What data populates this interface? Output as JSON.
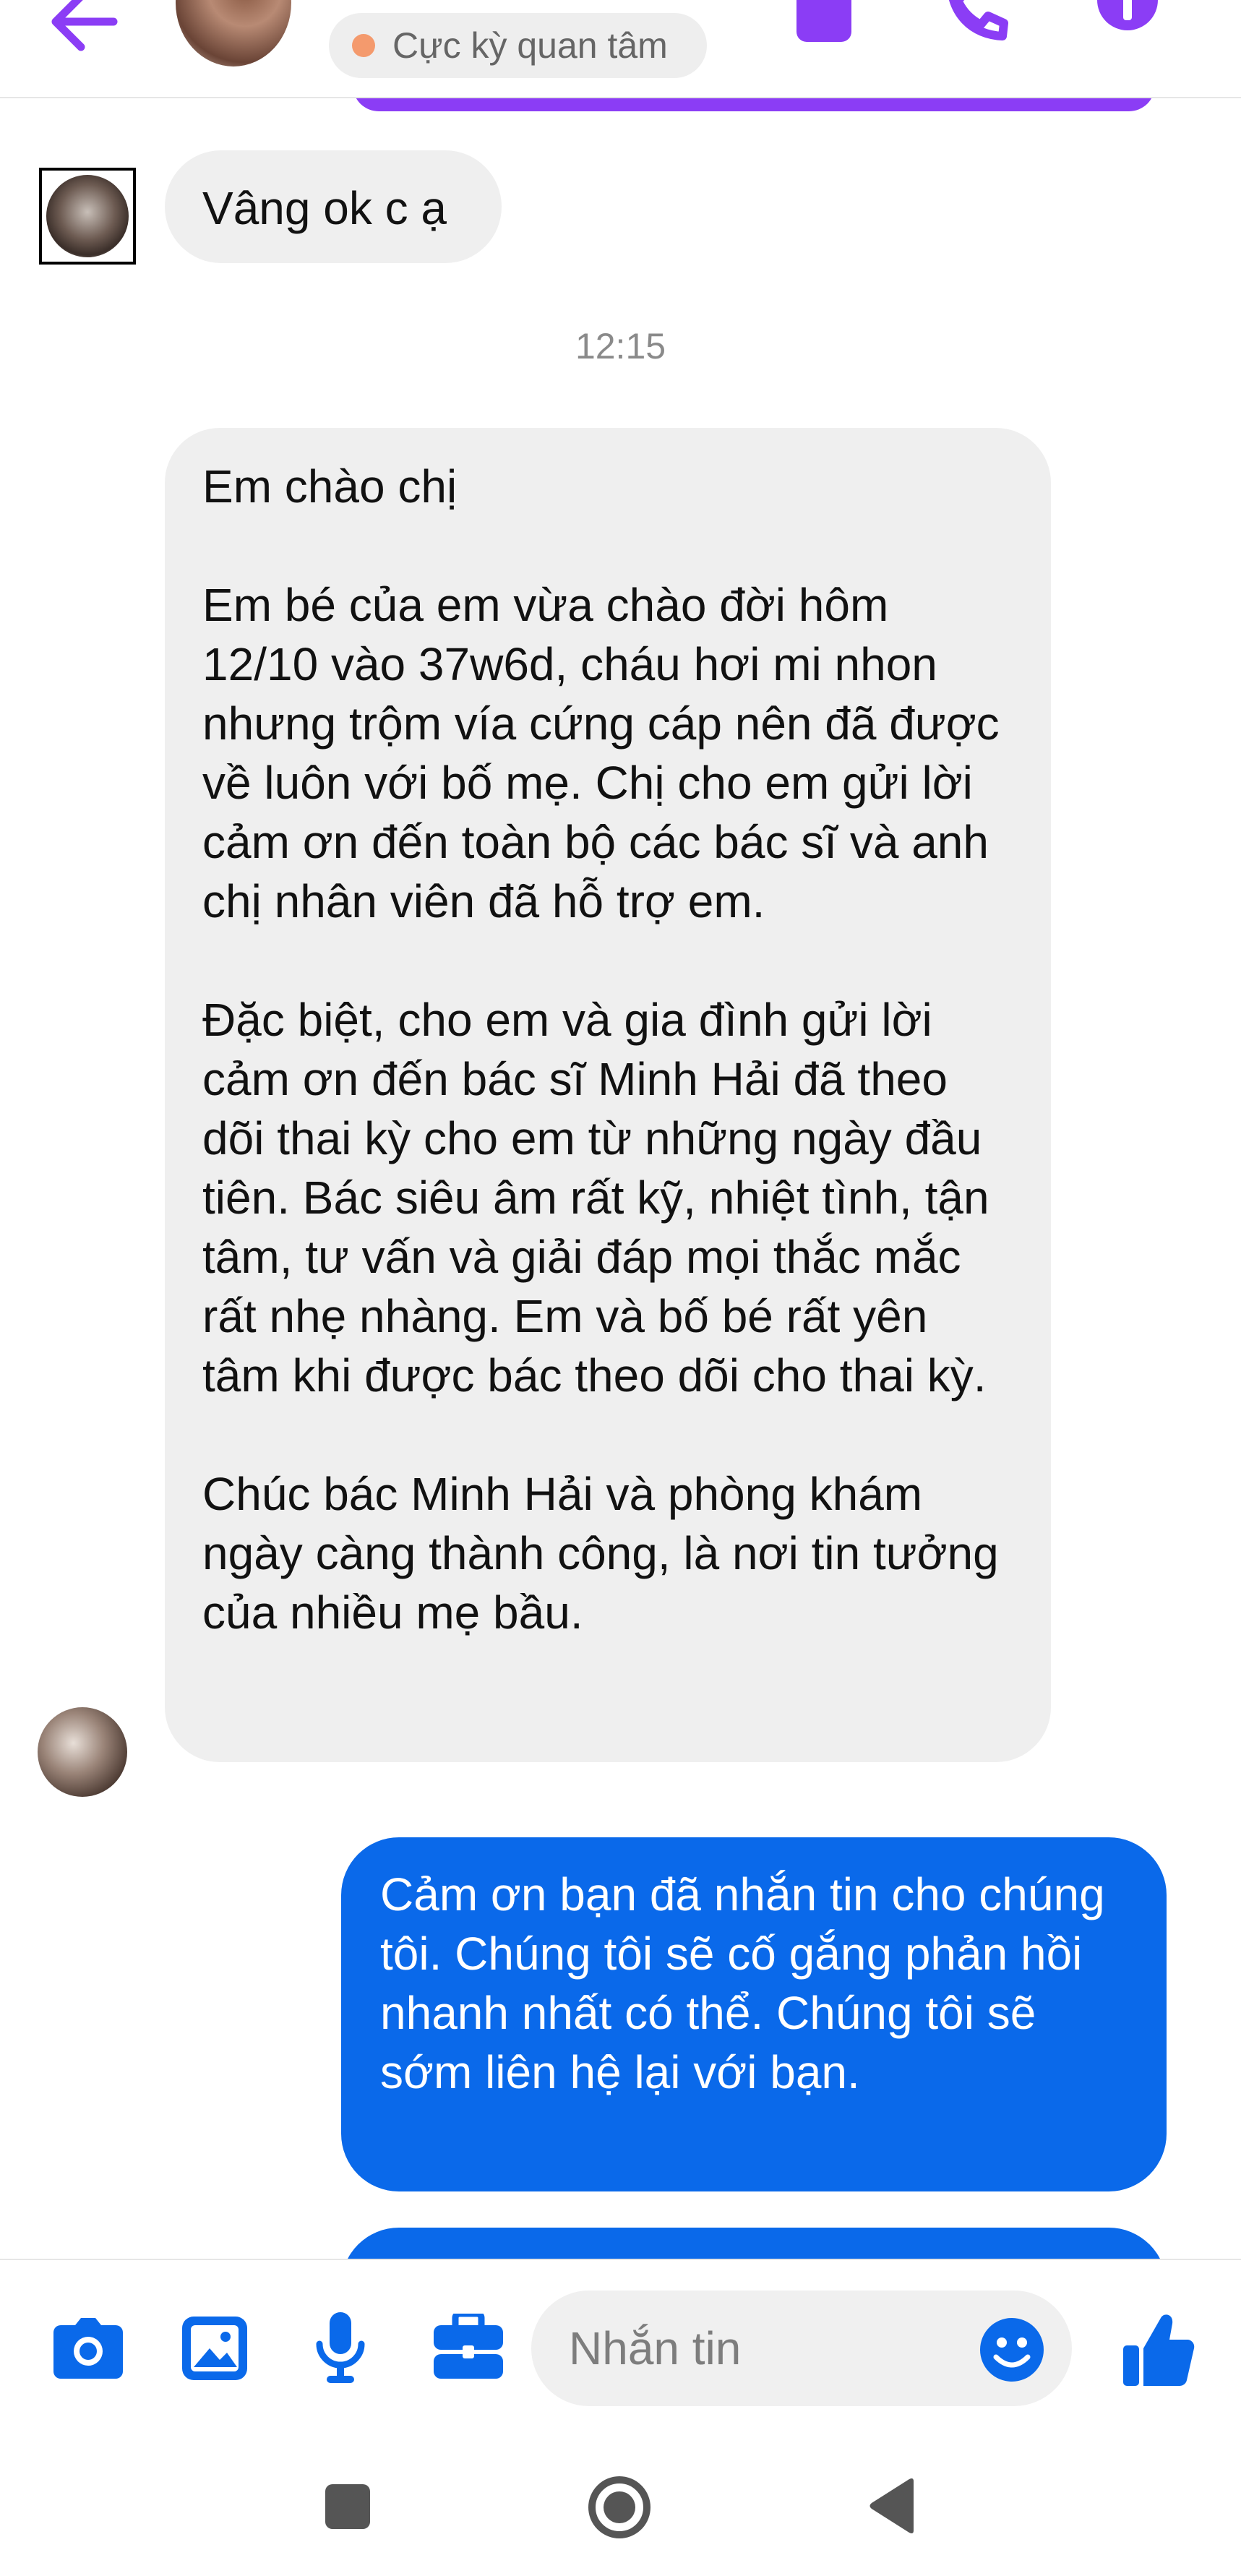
{
  "header": {
    "status_label": "Cực kỳ quan tâm",
    "accent_color": "#8b3df5",
    "icons": [
      "back-arrow-icon",
      "contact-avatar",
      "video-call-icon",
      "phone-icon",
      "info-icon"
    ]
  },
  "messages": {
    "msg1": "Vâng ok c ạ",
    "timestamp": "12:15",
    "msg2": {
      "p1": "Em chào chị",
      "p2": "Em bé của em vừa chào đời hôm 12/10 vào 37w6d, cháu hơi mi nhon nhưng trộm vía cứng cáp nên đã được về luôn với bố mẹ. Chị cho em gửi lời cảm ơn đến toàn bộ các bác sĩ và anh chị nhân viên đã hỗ trợ em.",
      "p3": "Đặc biệt, cho em và gia đình gửi lời cảm ơn đến bác sĩ Minh Hải đã theo dõi thai kỳ cho em từ những ngày đầu tiên. Bác siêu âm rất kỹ, nhiệt tình, tận tâm, tư vấn và giải đáp mọi thắc mắc rất nhẹ nhàng. Em và bố bé rất yên tâm khi được bác theo dõi cho thai kỳ.",
      "p4": "Chúc bác Minh Hải và phòng khám ngày càng thành công, là nơi tin tưởng của nhiều mẹ bầu."
    },
    "msg3": "Cảm ơn bạn đã nhắn tin cho chúng tôi. Chúng tôi sẽ cố gắng phản hồi nhanh nhất có thể. Chúng tôi sẽ sớm liên hệ lại với bạn.",
    "incoming_bubble_color": "#efefef",
    "outgoing_bubble_color": "#0a69ea"
  },
  "composer": {
    "placeholder": "Nhắn tin",
    "icons": [
      "camera-icon",
      "gallery-icon",
      "microphone-icon",
      "briefcase-icon",
      "emoji-icon",
      "thumbs-up-icon"
    ],
    "icon_color": "#0a69ea"
  },
  "navbar": {
    "icons": [
      "recents-icon",
      "home-icon",
      "back-icon"
    ]
  }
}
